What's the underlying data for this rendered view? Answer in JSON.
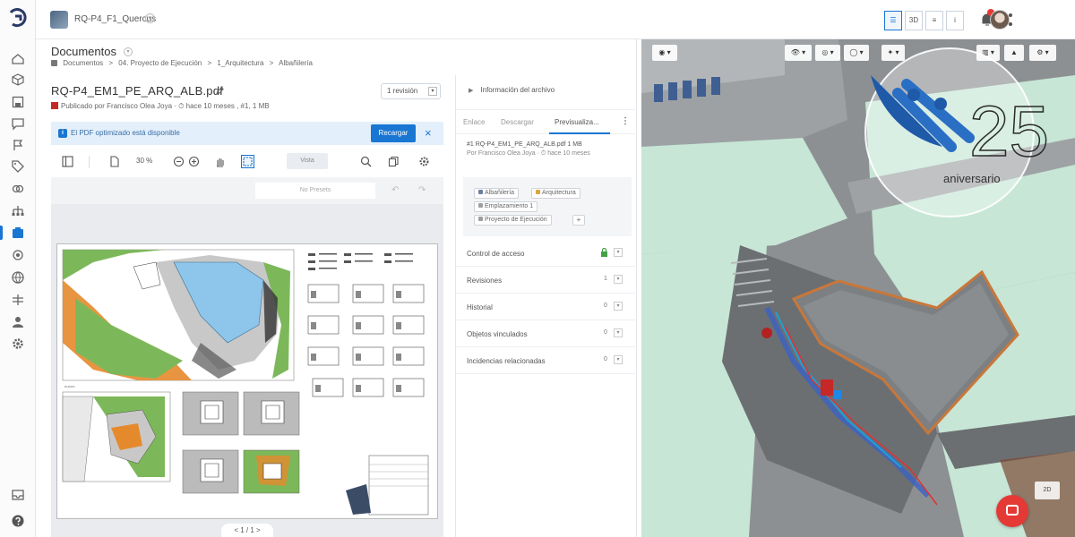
{
  "topbar": {
    "project_name": "RQ-P4_F1_Quercus",
    "view_3d_label": "3D",
    "view_info_label": "i"
  },
  "documents": {
    "title": "Documentos",
    "breadcrumb": [
      "Documentos",
      ">",
      "04. Proyecto de Ejecución",
      ">",
      "1_Arquitectura",
      ">",
      "Albañilería"
    ]
  },
  "file": {
    "name": "RQ-P4_EM1_PE_ARQ_ALB.pdf",
    "published_line": "Publicado por Francisco Olea Joya · ⏱ hace 10 meses , #1, 1 MB",
    "revision_select": "1 revisión"
  },
  "banner": {
    "message": "El PDF optimizado está disponible",
    "reload_label": "Recargar"
  },
  "pdf_toolbar": {
    "zoom": "30 %",
    "view_label": "Vista",
    "no_presets": "No Presets"
  },
  "pdf_pager": "< 1 / 1 >",
  "info_panel": {
    "header": "Información del archivo",
    "tabs": [
      "Enlace",
      "Descargar",
      "Previsualiza..."
    ],
    "meta_title": "#1 RQ-P4_EM1_PE_ARQ_ALB.pdf 1 MB",
    "meta_sub": "Por Francisco Olea Joya · ⏱ hace 10 meses",
    "tags": [
      {
        "label": "Albañilería",
        "color": "#6d7ea0"
      },
      {
        "label": "Arquitectura",
        "color": "#e0a43a"
      },
      {
        "label": "Emplazamiento 1",
        "color": "#9e9e9e"
      },
      {
        "label": "Proyecto de Ejecución",
        "color": "#9e9e9e"
      }
    ],
    "tag_add": "+",
    "sections": [
      {
        "label": "Control de acceso",
        "count": ""
      },
      {
        "label": "Revisiones",
        "count": "1"
      },
      {
        "label": "Historial",
        "count": "0"
      },
      {
        "label": "Objetos vinculados",
        "count": "0"
      },
      {
        "label": "Incidencias relacionadas",
        "count": "0"
      }
    ]
  },
  "viewer": {
    "mode_badge": "2D"
  },
  "watermark": {
    "number": "25",
    "text": "aniversario"
  },
  "colors": {
    "accent": "#1976d2",
    "danger": "#e53935",
    "banner_bg": "#e3effb"
  }
}
